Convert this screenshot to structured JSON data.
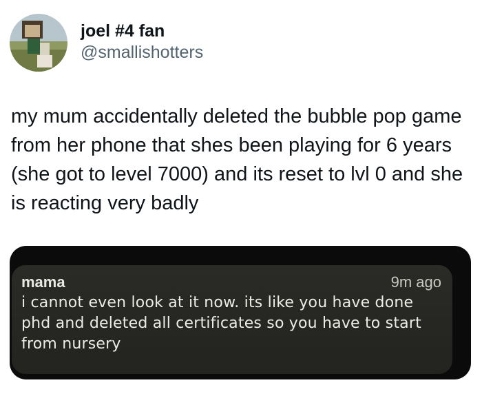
{
  "tweet": {
    "author": {
      "display_name": "joel #4 fan",
      "handle": "@smallishotters"
    },
    "text": "my mum accidentally deleted the bubble pop game from her phone that shes been playing for 6 years (she got to level 7000) and its reset to lvl 0 and she is reacting very badly"
  },
  "notification": {
    "sender": "mama",
    "time": "9m ago",
    "message": "i cannot even look at it now. its like you have done phd and deleted all certificates so you have to start from nursery"
  }
}
